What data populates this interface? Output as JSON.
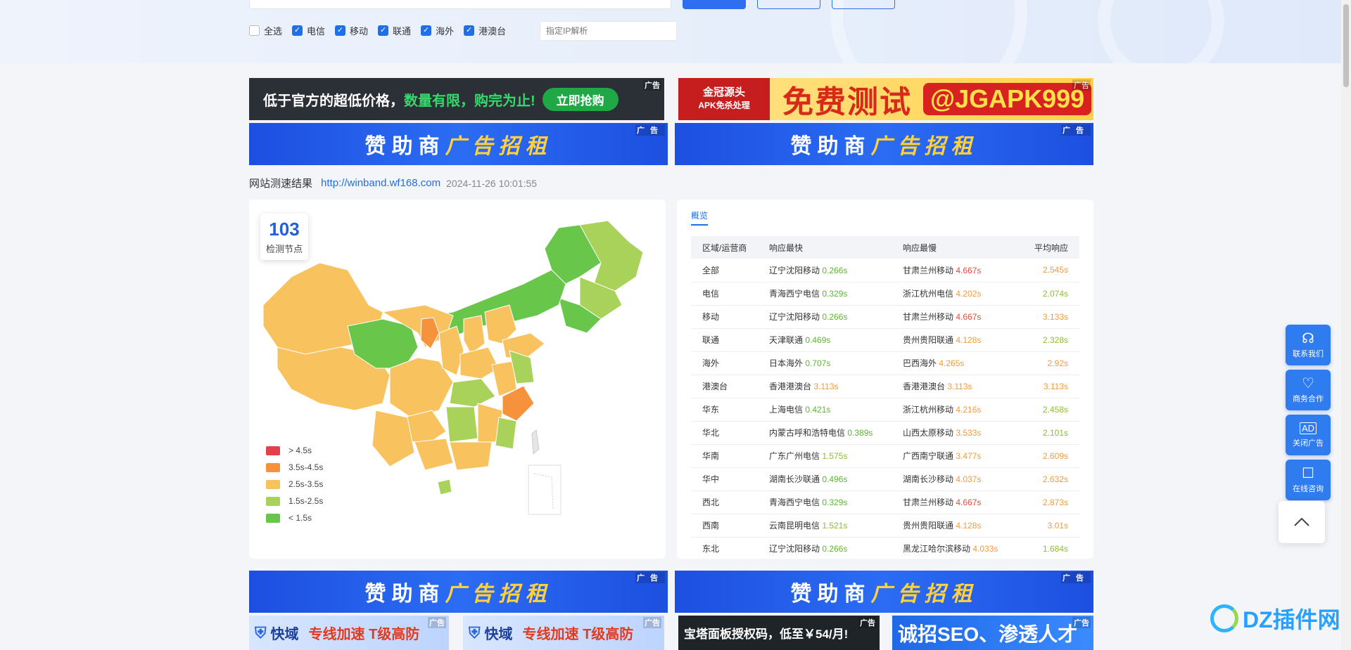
{
  "filters": {
    "options": [
      {
        "label": "全选",
        "checked": false
      },
      {
        "label": "电信",
        "checked": true
      },
      {
        "label": "移动",
        "checked": true
      },
      {
        "label": "联通",
        "checked": true
      },
      {
        "label": "海外",
        "checked": true
      },
      {
        "label": "港澳台",
        "checked": true
      }
    ],
    "ip_placeholder": "指定IP解析"
  },
  "ads": {
    "tag": "广告",
    "promo1": {
      "text1": "低于官方的超低价格，",
      "text2": "数量有限，购完为止!",
      "cta": "立即抢购"
    },
    "promo2": {
      "logo1": "金冠源头",
      "logo2": "APK免杀处理",
      "mid": "免费测试",
      "tail": "@JGAPK999"
    },
    "sponsor": {
      "part1": "赞助商",
      "part2": "广告招租"
    },
    "bottom": [
      {
        "brand": "快域",
        "text": "专线加速 T级高防"
      },
      {
        "brand": "快域",
        "text": "专线加速 T级高防"
      },
      {
        "text": "宝塔面板授权码，低至￥54/月!"
      },
      {
        "text": "诚招SEO、渗透人才"
      }
    ]
  },
  "result": {
    "label": "网站测速结果",
    "url": "http://winband.wf168.com",
    "time": "2024-11-26 10:01:55"
  },
  "map_card": {
    "count": "103",
    "count_label": "检测节点",
    "legend": [
      {
        "label": "> 4.5s",
        "color": "#e0414c"
      },
      {
        "label": "3.5s-4.5s",
        "color": "#f7923c"
      },
      {
        "label": "2.5s-3.5s",
        "color": "#f8c35f"
      },
      {
        "label": "1.5s-2.5s",
        "color": "#a9d25a"
      },
      {
        "label": "< 1.5s",
        "color": "#68c74a"
      }
    ]
  },
  "overview": {
    "tab": "概览",
    "headers": [
      "区域/运营商",
      "响应最快",
      "响应最慢",
      "平均响应"
    ],
    "rows": [
      {
        "region": "全部",
        "fast": "辽宁沈阳移动",
        "fast_t": "0.266s",
        "slow": "甘肃兰州移动",
        "slow_t": "4.667s",
        "avg": "2.545s"
      },
      {
        "region": "电信",
        "fast": "青海西宁电信",
        "fast_t": "0.329s",
        "slow": "浙江杭州电信",
        "slow_t": "4.202s",
        "avg": "2.074s"
      },
      {
        "region": "移动",
        "fast": "辽宁沈阳移动",
        "fast_t": "0.266s",
        "slow": "甘肃兰州移动",
        "slow_t": "4.667s",
        "avg": "3.133s"
      },
      {
        "region": "联通",
        "fast": "天津联通",
        "fast_t": "0.469s",
        "slow": "贵州贵阳联通",
        "slow_t": "4.128s",
        "avg": "2.328s"
      },
      {
        "region": "海外",
        "fast": "日本海外",
        "fast_t": "0.707s",
        "slow": "巴西海外",
        "slow_t": "4.265s",
        "avg": "2.92s"
      },
      {
        "region": "港澳台",
        "fast": "香港港澳台",
        "fast_t": "3.113s",
        "slow": "香港港澳台",
        "slow_t": "3.113s",
        "avg": "3.113s"
      },
      {
        "region": "华东",
        "fast": "上海电信",
        "fast_t": "0.421s",
        "slow": "浙江杭州移动",
        "slow_t": "4.216s",
        "avg": "2.458s"
      },
      {
        "region": "华北",
        "fast": "内蒙古呼和浩特电信",
        "fast_t": "0.389s",
        "slow": "山西太原移动",
        "slow_t": "3.533s",
        "avg": "2.101s"
      },
      {
        "region": "华南",
        "fast": "广东广州电信",
        "fast_t": "1.575s",
        "slow": "广西南宁联通",
        "slow_t": "3.477s",
        "avg": "2.609s"
      },
      {
        "region": "华中",
        "fast": "湖南长沙联通",
        "fast_t": "0.496s",
        "slow": "湖南长沙移动",
        "slow_t": "4.037s",
        "avg": "2.632s"
      },
      {
        "region": "西北",
        "fast": "青海西宁电信",
        "fast_t": "0.329s",
        "slow": "甘肃兰州移动",
        "slow_t": "4.667s",
        "avg": "2.873s"
      },
      {
        "region": "西南",
        "fast": "云南昆明电信",
        "fast_t": "1.521s",
        "slow": "贵州贵阳联通",
        "slow_t": "4.128s",
        "avg": "3.01s"
      },
      {
        "region": "东北",
        "fast": "辽宁沈阳移动",
        "fast_t": "0.266s",
        "slow": "黑龙江哈尔滨移动",
        "slow_t": "4.033s",
        "avg": "1.684s"
      }
    ]
  },
  "float_tools": [
    {
      "label": "联系我们",
      "icon": "headset-icon"
    },
    {
      "label": "商务合作",
      "icon": "heart-handshake-icon"
    },
    {
      "label": "关闭广告",
      "icon": "ad-icon"
    },
    {
      "label": "在线咨询",
      "icon": "chat-icon"
    }
  ],
  "watermark": {
    "text": "DZ插件网"
  }
}
